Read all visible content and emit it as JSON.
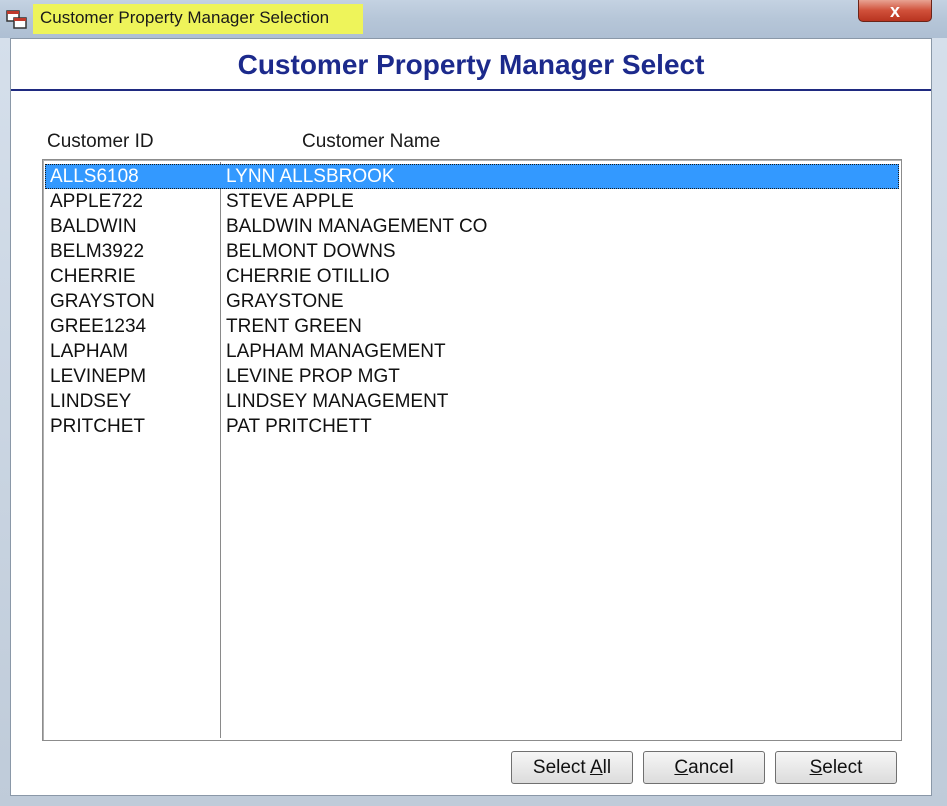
{
  "window": {
    "title": "Customer Property Manager Selection",
    "close_glyph": "x"
  },
  "header": {
    "title": "Customer Property Manager Select"
  },
  "columns": {
    "id": "Customer ID",
    "name": "Customer Name"
  },
  "rows": [
    {
      "id": "ALLS6108",
      "name": "LYNN ALLSBROOK"
    },
    {
      "id": "APPLE722",
      "name": "STEVE APPLE"
    },
    {
      "id": "BALDWIN",
      "name": "BALDWIN MANAGEMENT CO"
    },
    {
      "id": "BELM3922",
      "name": "BELMONT DOWNS"
    },
    {
      "id": "CHERRIE",
      "name": "CHERRIE OTILLIO"
    },
    {
      "id": "GRAYSTON",
      "name": "GRAYSTONE"
    },
    {
      "id": "GREE1234",
      "name": "TRENT GREEN"
    },
    {
      "id": "LAPHAM",
      "name": "LAPHAM MANAGEMENT"
    },
    {
      "id": "LEVINEPM",
      "name": "LEVINE PROP MGT"
    },
    {
      "id": "LINDSEY",
      "name": "LINDSEY MANAGEMENT"
    },
    {
      "id": "PRITCHET",
      "name": "PAT PRITCHETT"
    }
  ],
  "selected_row": "ALLS6108",
  "buttons": {
    "select_all": {
      "pre": "Select ",
      "key": "A",
      "post": "ll"
    },
    "cancel": {
      "pre": "",
      "key": "C",
      "post": "ancel"
    },
    "select": {
      "pre": "",
      "key": "S",
      "post": "elect"
    }
  },
  "colors": {
    "title_highlight": "#eef45a",
    "header_text": "#1c2a8c",
    "selection": "#3399ff"
  },
  "icons": {
    "app": "app-window-icon",
    "close": "close-icon"
  }
}
